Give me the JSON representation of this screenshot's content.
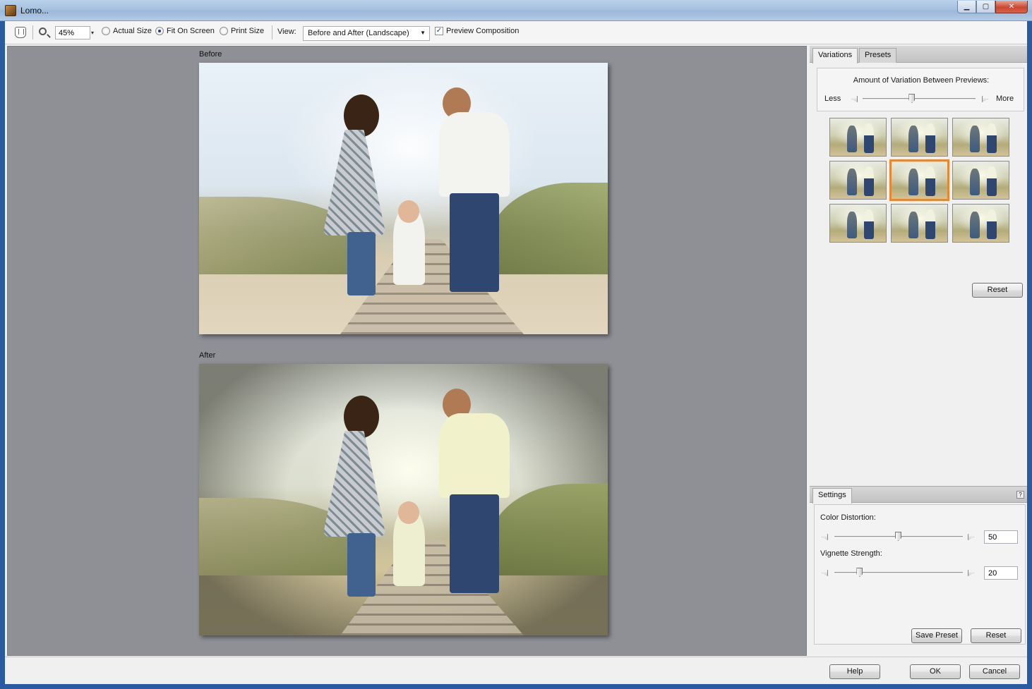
{
  "window": {
    "title": "Lomo...",
    "minimize": "▁",
    "maximize": "▢",
    "close": "✕"
  },
  "toolbar": {
    "zoom_value": "45%",
    "zoom_dropdown": "▾",
    "view_options": [
      {
        "label": "Actual Size",
        "checked": false
      },
      {
        "label": "Fit On Screen",
        "checked": true
      },
      {
        "label": "Print Size",
        "checked": false
      }
    ],
    "view_label": "View:",
    "view_selected": "Before and After (Landscape)",
    "view_arrow": "▼",
    "preview_composition_label": "Preview Composition",
    "preview_composition_checked": true,
    "checkmark": "✓"
  },
  "preview": {
    "before_label": "Before",
    "after_label": "After"
  },
  "variations_panel": {
    "tabs": [
      "Variations",
      "Presets"
    ],
    "active_tab": "Variations",
    "amount_title": "Amount of Variation Between Previews:",
    "less_label": "Less",
    "more_label": "More",
    "amount_fraction": 0.44,
    "selected_thumbnail": 4,
    "reset_label": "Reset"
  },
  "settings_panel": {
    "tab": "Settings",
    "help": "?",
    "color_distortion": {
      "label": "Color Distortion:",
      "value": "50",
      "fraction": 0.5
    },
    "vignette_strength": {
      "label": "Vignette Strength:",
      "value": "20",
      "fraction": 0.2
    },
    "save_preset_label": "Save Preset",
    "reset_label": "Reset"
  },
  "footer": {
    "help_label": "Help",
    "ok_label": "OK",
    "cancel_label": "Cancel"
  },
  "colors": {
    "selected_thumbnail_border": "#e8872e",
    "preview_background": "#8e9096"
  }
}
